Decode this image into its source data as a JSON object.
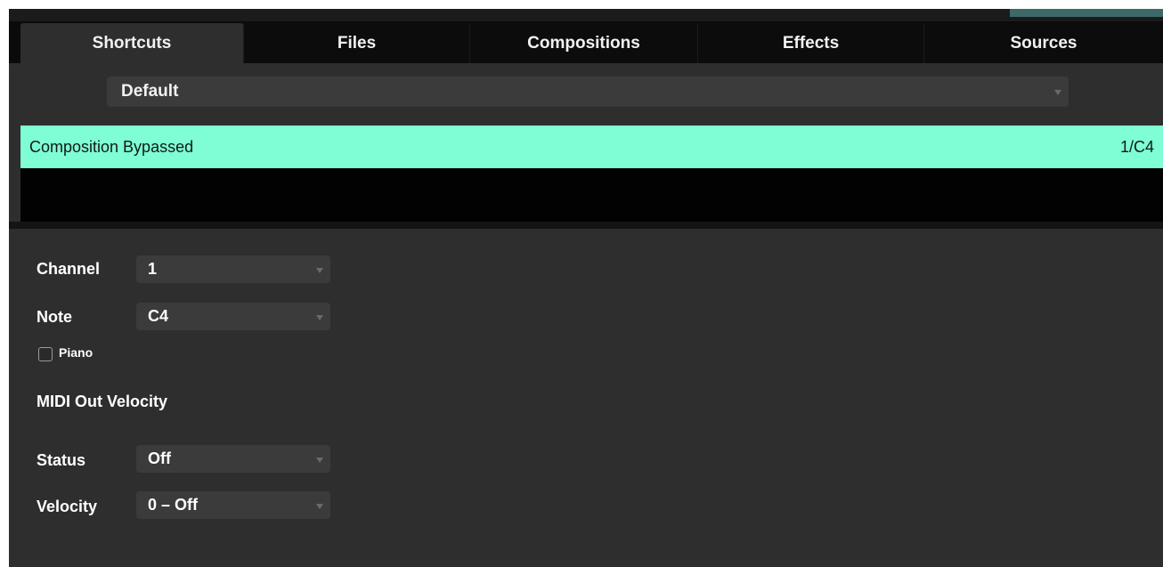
{
  "tabs": [
    {
      "label": "Shortcuts",
      "active": true
    },
    {
      "label": "Files",
      "active": false
    },
    {
      "label": "Compositions",
      "active": false
    },
    {
      "label": "Effects",
      "active": false
    },
    {
      "label": "Sources",
      "active": false
    }
  ],
  "preset": {
    "selected": "Default"
  },
  "shortcut_list": {
    "rows": [
      {
        "name": "Composition Bypassed",
        "binding": "1/C4",
        "selected": true
      }
    ]
  },
  "editor": {
    "channel": {
      "label": "Channel",
      "value": "1"
    },
    "note": {
      "label": "Note",
      "value": "C4"
    },
    "piano": {
      "label": "Piano",
      "checked": false
    },
    "midi_out_velocity": {
      "title": "MIDI Out Velocity"
    },
    "status": {
      "label": "Status",
      "value": "Off"
    },
    "velocity": {
      "label": "Velocity",
      "value": "0 – Off"
    }
  },
  "colors": {
    "selected_row": "#7ffdd4",
    "panel": "#2e2e2e",
    "background": "#1b1b1b"
  },
  "icons": {
    "dropdown": "chevron-down-icon",
    "checkbox": "checkbox-icon"
  }
}
